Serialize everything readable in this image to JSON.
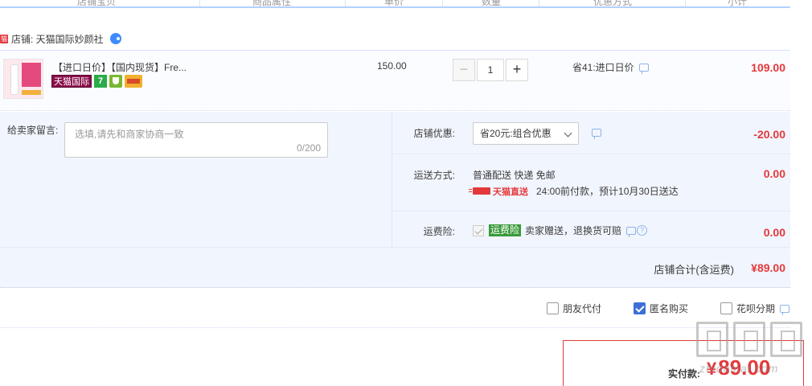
{
  "header": {
    "columns": [
      "店铺宝贝",
      "商品属性",
      "单价",
      "数量",
      "优惠方式",
      "小计"
    ]
  },
  "shop": {
    "tag": "猫",
    "name": "店铺: 天猫国际妙颜社"
  },
  "item": {
    "title": "【进口日价】【国内现货】Fre...",
    "badge_tmall": "天猫国际",
    "badge_seven": "7",
    "price": "150.00",
    "quantity": "1",
    "minus": "−",
    "plus": "+",
    "promo": "省41:进口日价",
    "subtotal": "109.00"
  },
  "message": {
    "label": "给卖家留言:",
    "placeholder": "选填,请先和商家协商一致",
    "count": "0/200"
  },
  "discount": {
    "label": "店铺优惠:",
    "selected": "省20元:组合优惠",
    "amount": "-20.00"
  },
  "shipping": {
    "label": "运送方式:",
    "method": "普通配送 快递 免邮",
    "tmall_direct": "天猫直送",
    "eta": "24:00前付款，预计10月30日送达",
    "amount": "0.00"
  },
  "insurance": {
    "label": "运费险:",
    "tag": "运费险",
    "text": "卖家赠送，退换货可赔",
    "help": "?",
    "amount": "0.00"
  },
  "shop_total": {
    "label": "店铺合计(含运费)",
    "amount": "¥89.00"
  },
  "options": {
    "friend_pay": "朋友代付",
    "anonymous": "匿名购买",
    "huabei": "花呗分期"
  },
  "payment": {
    "label": "实付款:",
    "yen": "¥",
    "amount": "89.00"
  },
  "watermark": {
    "text": "zhidemai.com"
  },
  "colors": {
    "accent_red": "#e4393c",
    "panel_bg": "#f1f5fd",
    "header_line": "#b2d1ff",
    "checkbox_blue": "#3d6fd8"
  }
}
